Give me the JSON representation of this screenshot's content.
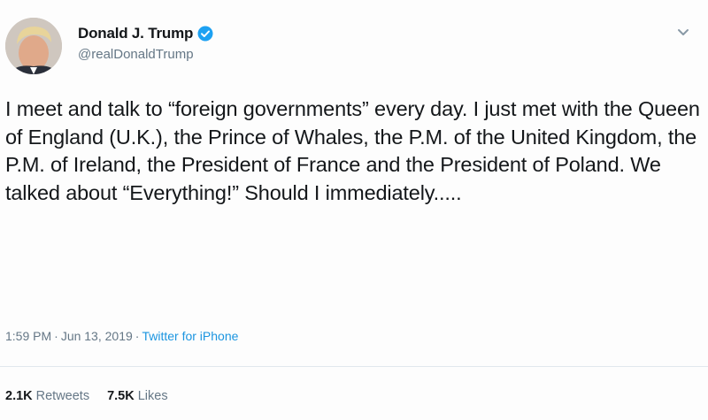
{
  "tweet": {
    "display_name": "Donald J. Trump",
    "handle": "@realDonaldTrump",
    "text": "I meet and talk to “foreign governments” every day. I just met with the Queen of England (U.K.), the Prince of Whales, the P.M. of the United Kingdom, the P.M. of Ireland, the President of France and the President of Poland. We talked about “Everything!” Should I immediately.....",
    "time": "1:59 PM",
    "date": "Jun 13, 2019",
    "separator": "·",
    "source": "Twitter for iPhone",
    "stats": {
      "retweets_count": "2.1K",
      "retweets_label": "Retweets",
      "likes_count": "7.5K",
      "likes_label": "Likes"
    }
  },
  "icons": {
    "verified": "verified-badge-icon",
    "caret": "chevron-down-icon"
  },
  "colors": {
    "verified_blue": "#1da1f2",
    "link_blue": "#1b95e0",
    "secondary_text": "#657786"
  }
}
